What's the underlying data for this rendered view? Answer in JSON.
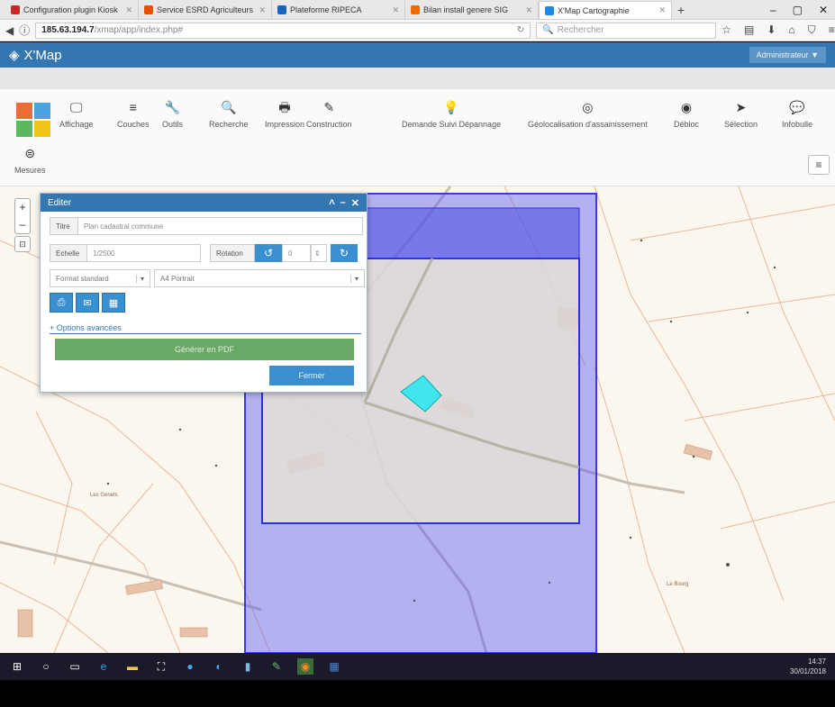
{
  "browser": {
    "tabs": [
      {
        "title": "Configuration plugin Kiosk",
        "color": "#c62828",
        "active": false
      },
      {
        "title": "Service ESRD Agriculteurs",
        "color": "#e65100",
        "active": false
      },
      {
        "title": "Plateforme RIPECA",
        "color": "#1565c0",
        "active": false
      },
      {
        "title": "Bilan install genere SIG",
        "color": "#ef6c00",
        "active": false
      },
      {
        "title": "X'Map Cartographie",
        "color": "#1e88e5",
        "active": true
      }
    ],
    "url_host": "185.63.194.7",
    "url_path": "/xmap/app/index.php#",
    "search_placeholder": "Rechercher"
  },
  "app": {
    "title": "X'Map",
    "user_button": "Administrateur ▼"
  },
  "toolbar": {
    "tools": [
      {
        "label": "Affichage",
        "icon": "monitor-icon",
        "glyph": "🖵"
      },
      {
        "label": "Couches",
        "icon": "layers-icon",
        "glyph": "≡"
      },
      {
        "label": "Outils",
        "icon": "wrench-icon",
        "glyph": "🔧"
      },
      {
        "label": "Recherche",
        "icon": "search-icon",
        "glyph": "🔍"
      },
      {
        "label": "Impression",
        "icon": "printer-icon",
        "glyph": "🖶"
      },
      {
        "label": "Construction",
        "icon": "pencil-icon",
        "glyph": "✎"
      },
      {
        "label": "Demande Suivi Dépannage",
        "icon": "bulb-icon",
        "glyph": "💡"
      },
      {
        "label": "Géolocalisation d'assainissement",
        "icon": "target-icon",
        "glyph": "◎"
      },
      {
        "label": "Débloc",
        "icon": "globe-icon",
        "glyph": "◉"
      },
      {
        "label": "Sélection",
        "icon": "cursor-icon",
        "glyph": "➤"
      },
      {
        "label": "Infobulle",
        "icon": "comment-icon",
        "glyph": "💬"
      }
    ],
    "extra_tool": {
      "label": "Mesures",
      "icon": "gauge-icon",
      "glyph": "⊜"
    },
    "menu_glyph": "≡"
  },
  "dialog": {
    "title": "Editer",
    "controls": [
      "˄",
      "–",
      "✕"
    ],
    "title_label": "Titre",
    "title_value": "Plan cadastral commune",
    "scale_label": "Echelle",
    "scale_value": "1/2500",
    "rotation_label": "Rotation",
    "rotation_value": "0",
    "format_value": "Format standard",
    "paper_value": "A4 Portrait",
    "options_link": "+ Options avancées",
    "print_button": "Générer en PDF",
    "close_button": "Fermer"
  },
  "map_labels": {
    "place": "Les Genets",
    "place2": "Le Bourg"
  },
  "taskbar": {
    "time": "14:37",
    "date": "30/01/2018"
  }
}
